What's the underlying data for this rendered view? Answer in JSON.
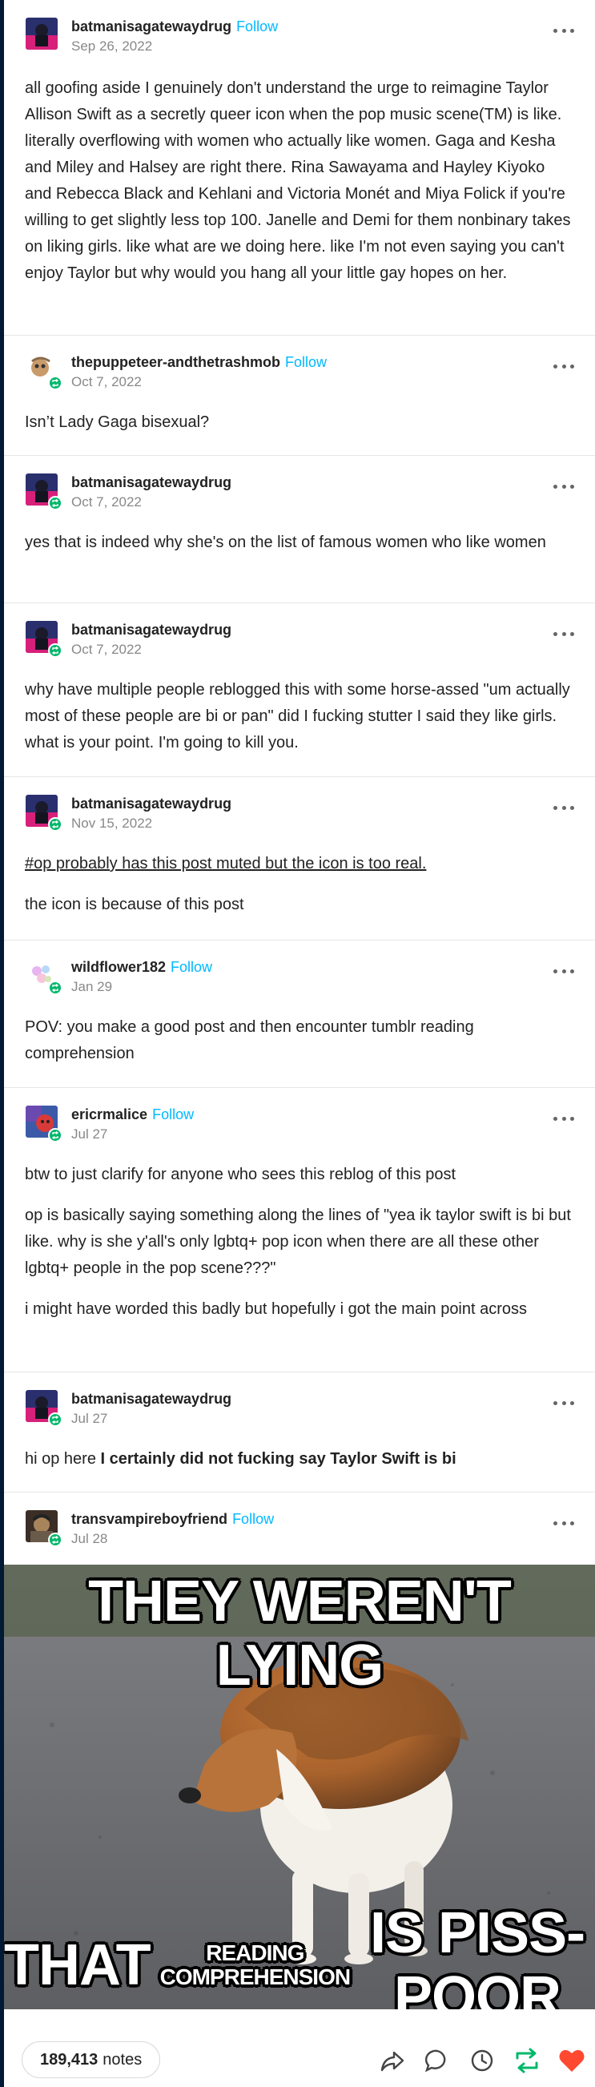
{
  "posts": [
    {
      "username": "batmanisagatewaydrug",
      "follow": "Follow",
      "date": "Sep 26, 2022",
      "reblogged": false,
      "paragraphs": [
        "all goofing aside I genuinely don't understand the urge to reimagine Taylor Allison Swift as a secretly queer icon when the pop music scene(TM) is like. literally overflowing with women who actually like women. Gaga and Kesha and Miley and Halsey are right there. Rina Sawayama and Hayley Kiyoko and Rebecca Black and Kehlani and Victoria Monét and Miya Folick if you're willing to get slightly less top 100. Janelle and Demi for them nonbinary takes on liking girls. like what are we doing here. like I'm not even saying you can't enjoy Taylor but why would you hang all your little gay hopes on her."
      ]
    },
    {
      "username": "thepuppeteer-andthetrashmob",
      "follow": "Follow",
      "date": "Oct 7, 2022",
      "paragraphs": [
        "Isn’t Lady Gaga bisexual?"
      ]
    },
    {
      "username": "batmanisagatewaydrug",
      "date": "Oct 7, 2022",
      "paragraphs": [
        "yes that is indeed why she's on the list of famous women who like women"
      ]
    },
    {
      "username": "batmanisagatewaydrug",
      "date": "Oct 7, 2022",
      "paragraphs": [
        "why have multiple people reblogged this with some horse-assed \"um actually most of these people are bi or pan\" did I fucking stutter I said they like girls. what is your point. I'm going to kill you."
      ]
    },
    {
      "username": "batmanisagatewaydrug",
      "date": "Nov 15, 2022",
      "tag": "#op probably has this post muted but the icon is too real.",
      "paragraphs": [
        "the icon is because of this post"
      ]
    },
    {
      "username": "wildflower182",
      "follow": "Follow",
      "date": "Jan 29",
      "paragraphs": [
        "POV: you make a good post and then encounter tumblr reading comprehension"
      ]
    },
    {
      "username": "ericrmalice",
      "follow": "Follow",
      "date": "Jul 27",
      "paragraphs": [
        "btw to just clarify for anyone who sees this reblog of this post",
        "op is basically saying something along the lines of \"yea ik taylor swift is bi but like. why is she y'all's only lgbtq+ pop icon when there are all these other lgbtq+ people in the pop scene???\"",
        "i might have worded this badly but hopefully i got the main point across"
      ]
    },
    {
      "username": "batmanisagatewaydrug",
      "date": "Jul 27",
      "prefix": "hi op here ",
      "bold": "I certainly did not fucking say Taylor Swift is bi"
    },
    {
      "username": "transvampireboyfriend",
      "follow": "Follow",
      "date": "Jul 28"
    }
  ],
  "meme": {
    "top": "THEY WEREN'T LYING",
    "bottom_left": "THAT",
    "small_top": "READING",
    "small_bottom": "COMPREHENSION",
    "bottom_right": "IS PISS-POOR"
  },
  "footer": {
    "notes_count": "189,413",
    "notes_label": "notes"
  },
  "colors": {
    "follow": "#00b8ff",
    "reblog_badge": "#00b86b",
    "reblog_action": "#00b86b",
    "like": "#ff4930",
    "background": "#001935"
  }
}
